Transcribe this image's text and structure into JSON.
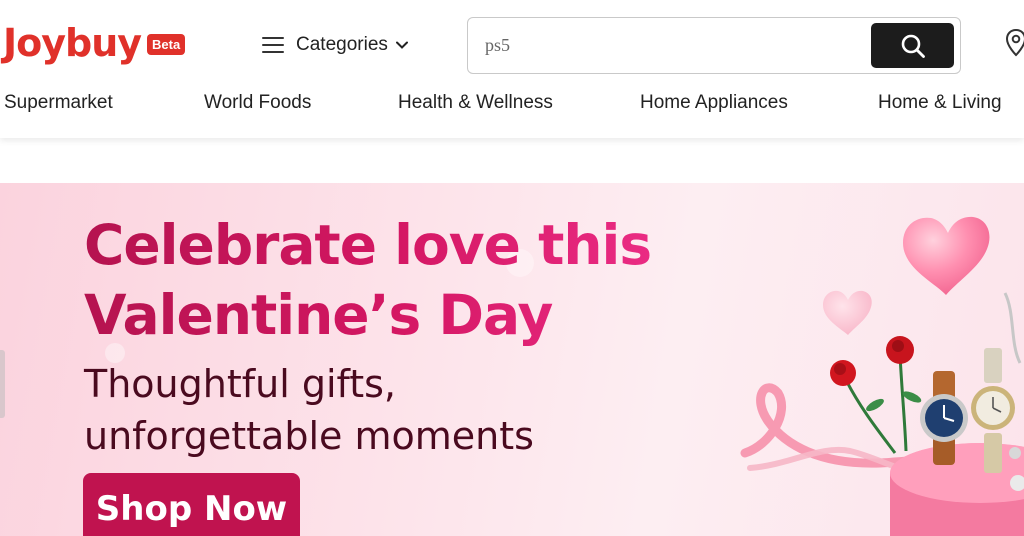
{
  "header": {
    "logo": "Joybuy",
    "badge": "Beta",
    "categories_label": "Categories",
    "search": {
      "value": "ps5",
      "placeholder": ""
    }
  },
  "nav": {
    "items": [
      {
        "label": "Supermarket"
      },
      {
        "label": "World Foods"
      },
      {
        "label": "Health & Wellness"
      },
      {
        "label": "Home Appliances"
      },
      {
        "label": "Home & Living"
      }
    ]
  },
  "hero": {
    "headline_line1": "Celebrate love this",
    "headline_line2": "Valentine’s Day",
    "subline1": "Thoughtful gifts,",
    "subline2": "unforgettable moments",
    "cta": "Shop Now"
  },
  "icons": {
    "menu": "hamburger-icon",
    "chevron": "chevron-down-icon",
    "search": "search-icon",
    "location": "location-pin-icon"
  },
  "colors": {
    "brand_red": "#e0312a",
    "hero_pink": "#d41763",
    "cta_bg": "#c0134f",
    "search_btn": "#1c1c1c"
  }
}
